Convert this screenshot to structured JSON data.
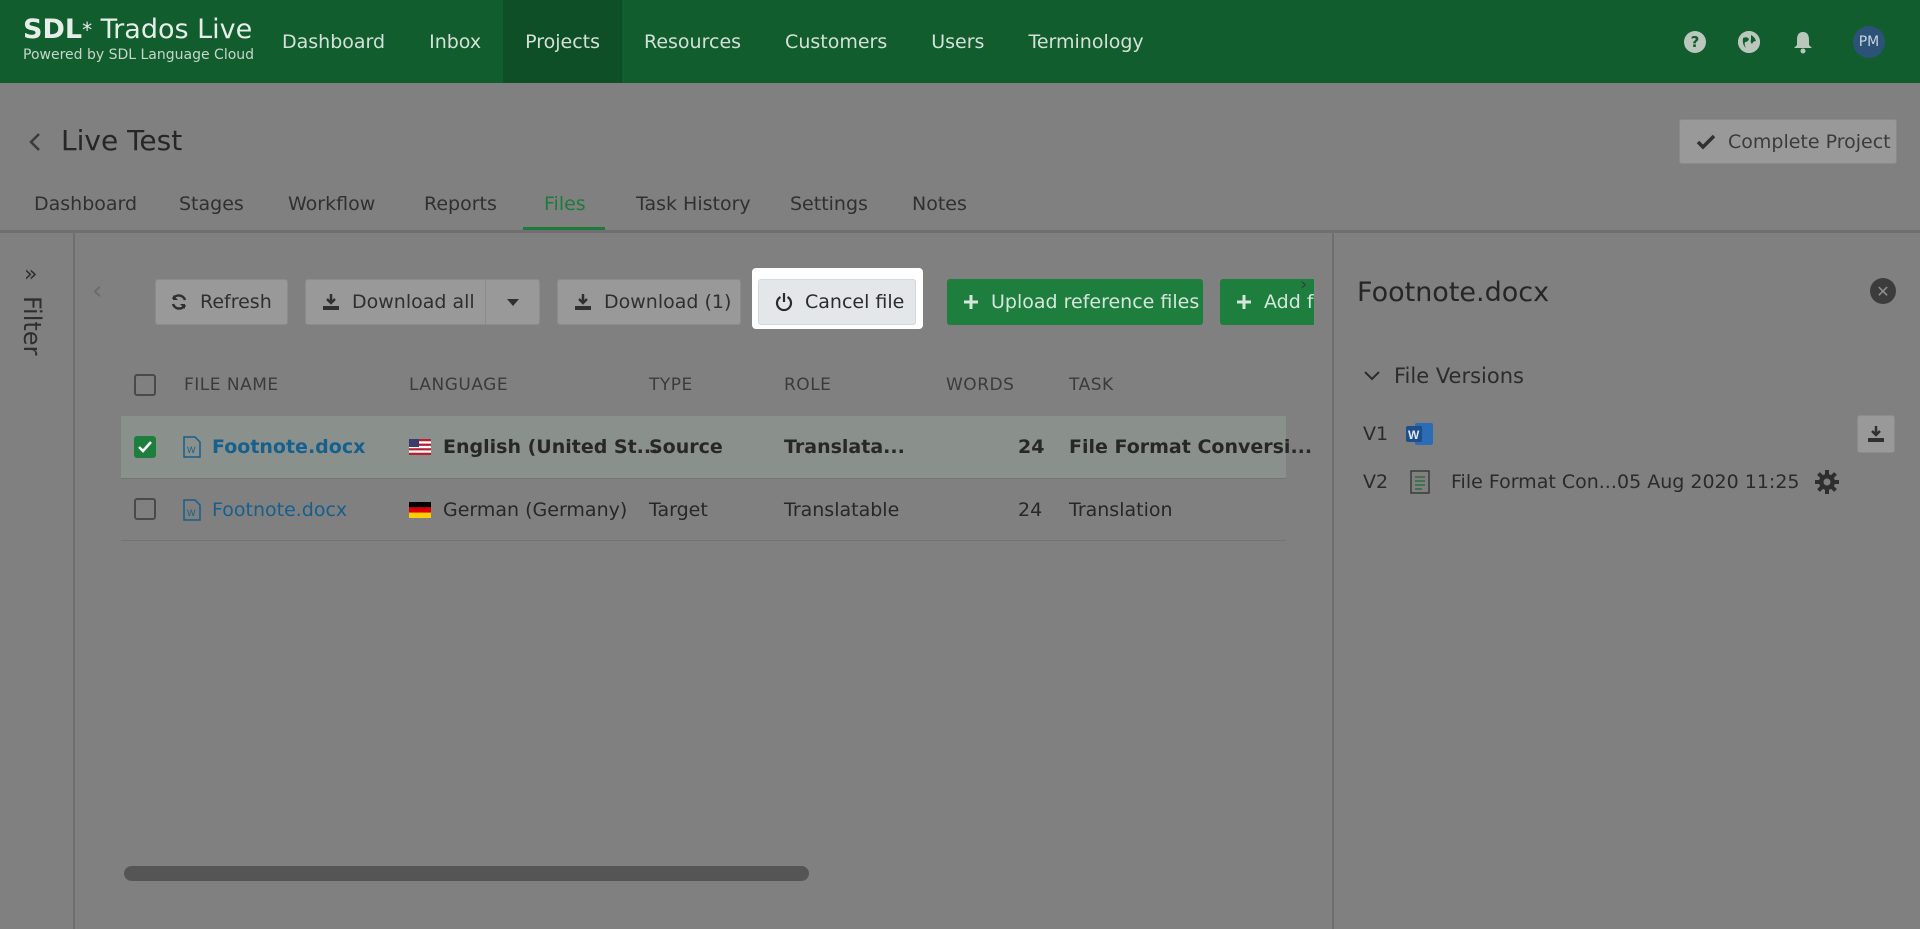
{
  "app": {
    "brand_prefix": "SDL",
    "brand_mark": "*",
    "brand_name": " Trados Live",
    "tagline": "Powered by SDL Language Cloud"
  },
  "topnav": {
    "items": [
      {
        "label": "Dashboard",
        "active": false
      },
      {
        "label": "Inbox",
        "active": false
      },
      {
        "label": "Projects",
        "active": true
      },
      {
        "label": "Resources",
        "active": false
      },
      {
        "label": "Customers",
        "active": false
      },
      {
        "label": "Users",
        "active": false
      },
      {
        "label": "Terminology",
        "active": false
      }
    ],
    "icons": [
      "help-icon",
      "globe-icon",
      "bell-icon"
    ],
    "avatar_initials": "PM"
  },
  "project": {
    "title": "Live Test",
    "complete_label": "Complete Project"
  },
  "tabs": [
    {
      "label": "Dashboard"
    },
    {
      "label": "Stages"
    },
    {
      "label": "Workflow"
    },
    {
      "label": "Reports"
    },
    {
      "label": "Files",
      "active": true
    },
    {
      "label": "Task History"
    },
    {
      "label": "Settings"
    },
    {
      "label": "Notes"
    }
  ],
  "filter": {
    "label": "Filter"
  },
  "toolbar": {
    "refresh_label": "Refresh",
    "download_all_label": "Download all",
    "download_selected_label": "Download (1)",
    "cancel_file_label": "Cancel file",
    "upload_reference_label": "Upload reference files",
    "add_files_label": "Add f"
  },
  "table": {
    "headers": [
      "FILE NAME",
      "LANGUAGE",
      "TYPE",
      "ROLE",
      "WORDS",
      "TASK"
    ],
    "rows": [
      {
        "selected": true,
        "file": "Footnote.docx",
        "flag": "us",
        "language": "English (United St...",
        "type": "Source",
        "role": "Translata...",
        "words": "24",
        "task": "File Format Conversi..."
      },
      {
        "selected": false,
        "file": "Footnote.docx",
        "flag": "de",
        "language": "German (Germany)",
        "type": "Target",
        "role": "Translatable",
        "words": "24",
        "task": "Translation"
      }
    ]
  },
  "panel": {
    "title": "Footnote.docx",
    "versions_title": "File Versions",
    "versions": [
      {
        "label": "V1",
        "icon": "word-icon"
      },
      {
        "label": "V2",
        "icon": "document-icon",
        "name": "File Format Con...",
        "date": "05 Aug 2020 11:25"
      }
    ]
  },
  "colors": {
    "nav_green": "#125d2d",
    "action_green": "#1e7e3e",
    "link_blue": "#155f8c",
    "overlay_gray": "#808080"
  }
}
